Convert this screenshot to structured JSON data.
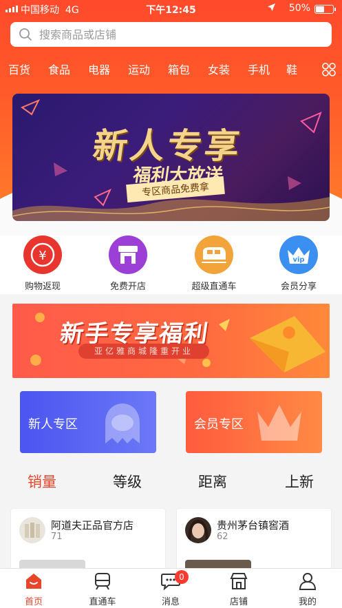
{
  "status_bar": {
    "carrier": "中国移动",
    "network": "4G",
    "time": "下午12:45",
    "battery": "50%"
  },
  "search": {
    "placeholder": "搜索商品或店铺"
  },
  "categories": [
    "百货",
    "食品",
    "电器",
    "运动",
    "箱包",
    "女装",
    "手机",
    "鞋"
  ],
  "banner_top": {
    "title": "新人专享",
    "subtitle": "福利大放送",
    "tag": "专区商品免费拿"
  },
  "quick_links": [
    {
      "label": "购物返现",
      "icon": "yen-icon",
      "color": "#e8352e"
    },
    {
      "label": "免费开店",
      "icon": "store-icon",
      "color": "#9b3fd6"
    },
    {
      "label": "超级直通车",
      "icon": "train-icon",
      "color": "#f2a33a"
    },
    {
      "label": "会员分享",
      "icon": "vip-crown-icon",
      "color": "#3a8ff0"
    }
  ],
  "banner_mid": {
    "title": "新手专享福利",
    "subtitle": "亚亿雅商城隆重开业"
  },
  "zones": [
    {
      "label": "新人专区",
      "icon": "ghost-icon"
    },
    {
      "label": "会员专区",
      "icon": "crown-icon"
    }
  ],
  "sort_tabs": [
    "销量",
    "等级",
    "距离",
    "上新"
  ],
  "shops": [
    {
      "name": "阿道夫正品官方店",
      "count": "71"
    },
    {
      "name": "贵州茅台镇窖酒",
      "count": "62"
    }
  ],
  "tabbar": [
    {
      "label": "首页",
      "icon": "home-icon"
    },
    {
      "label": "直通车",
      "icon": "train-icon"
    },
    {
      "label": "消息",
      "icon": "message-icon",
      "badge": "0"
    },
    {
      "label": "店铺",
      "icon": "shop-icon"
    },
    {
      "label": "我的",
      "icon": "user-icon"
    }
  ],
  "colors": {
    "accent": "#e8452d",
    "header": "#ff4a2b",
    "zone_new": "#4b55f0",
    "zone_vip": "#ff5b3d"
  }
}
